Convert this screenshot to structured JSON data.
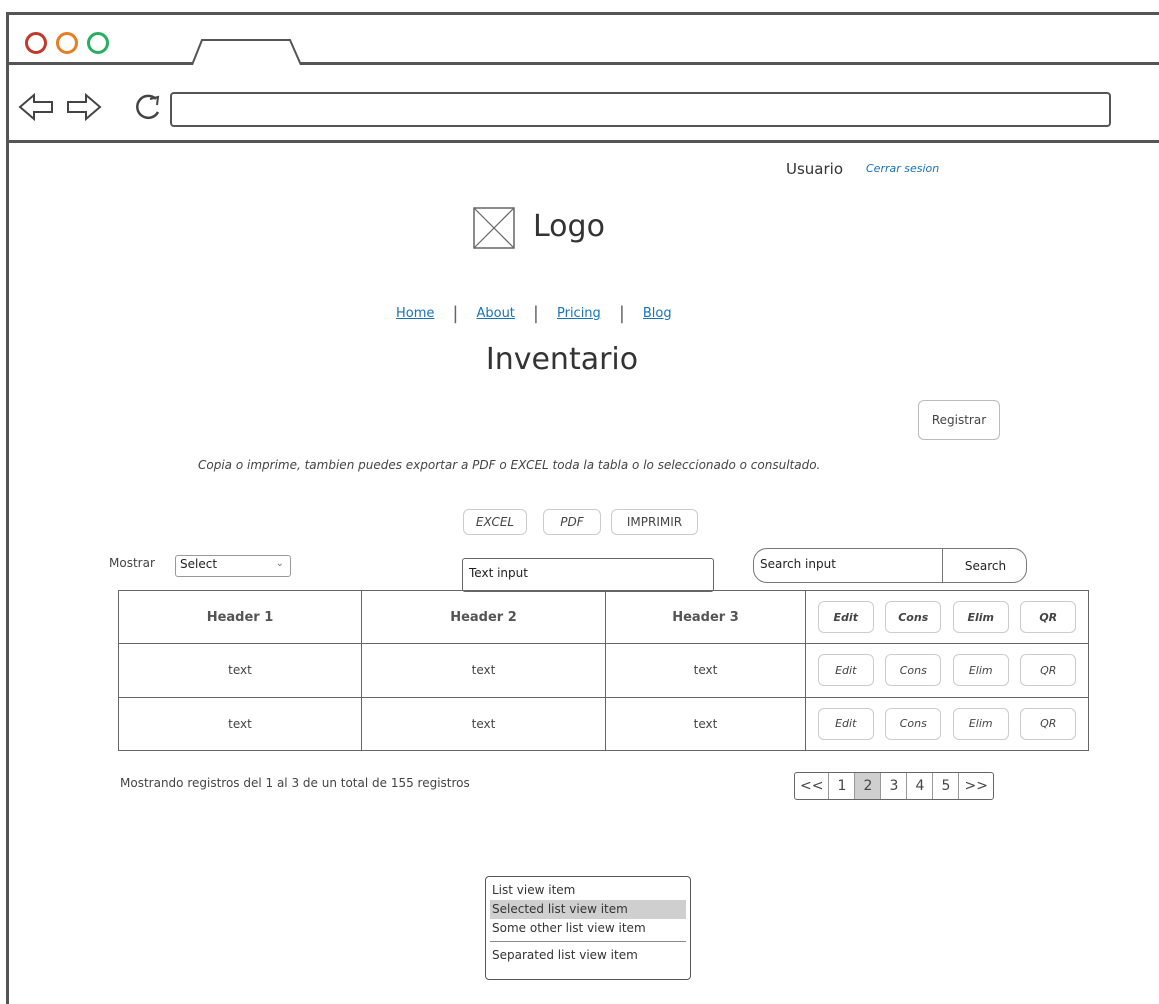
{
  "header": {
    "user_label": "Usuario",
    "logout_label": "Cerrar sesion",
    "logo_label": "Logo"
  },
  "nav": {
    "items": [
      "Home",
      "About",
      "Pricing",
      "Blog"
    ]
  },
  "page": {
    "title": "Inventario",
    "register_label": "Registrar",
    "info_text": "Copia o imprime, tambien puedes exportar a PDF o EXCEL toda la tabla o lo seleccionado o consultado."
  },
  "export": {
    "excel_label": "EXCEL",
    "pdf_label": "PDF",
    "print_label": "IMPRIMIR"
  },
  "controls": {
    "show_label": "Mostrar",
    "select_value": "Select",
    "text_input_placeholder": "Text input",
    "search_placeholder": "Search input",
    "search_button": "Search"
  },
  "table": {
    "headers": [
      "Header 1",
      "Header 2",
      "Header 3"
    ],
    "rows": [
      [
        "text",
        "text",
        "text"
      ],
      [
        "text",
        "text",
        "text"
      ]
    ],
    "actions": [
      "Edit",
      "Cons",
      "Elim",
      "QR"
    ]
  },
  "footer": {
    "showing_text": "Mostrando registros del 1 al 3 de un total de 155 registros"
  },
  "pagination": {
    "first": "<<",
    "pages": [
      "1",
      "2",
      "3",
      "4",
      "5"
    ],
    "active_page": "2",
    "last": ">>"
  },
  "listview": {
    "items": [
      "List view item",
      "Selected list view item",
      "Some other list view item"
    ],
    "selected_index": 1,
    "separated_item": "Separated list view item"
  },
  "colors": {
    "link": "#1a73b8",
    "frame": "#555555",
    "selected": "#cfcfcf",
    "dot_red": "#c0392b",
    "dot_orange": "#e67e22",
    "dot_green": "#27ae60"
  }
}
